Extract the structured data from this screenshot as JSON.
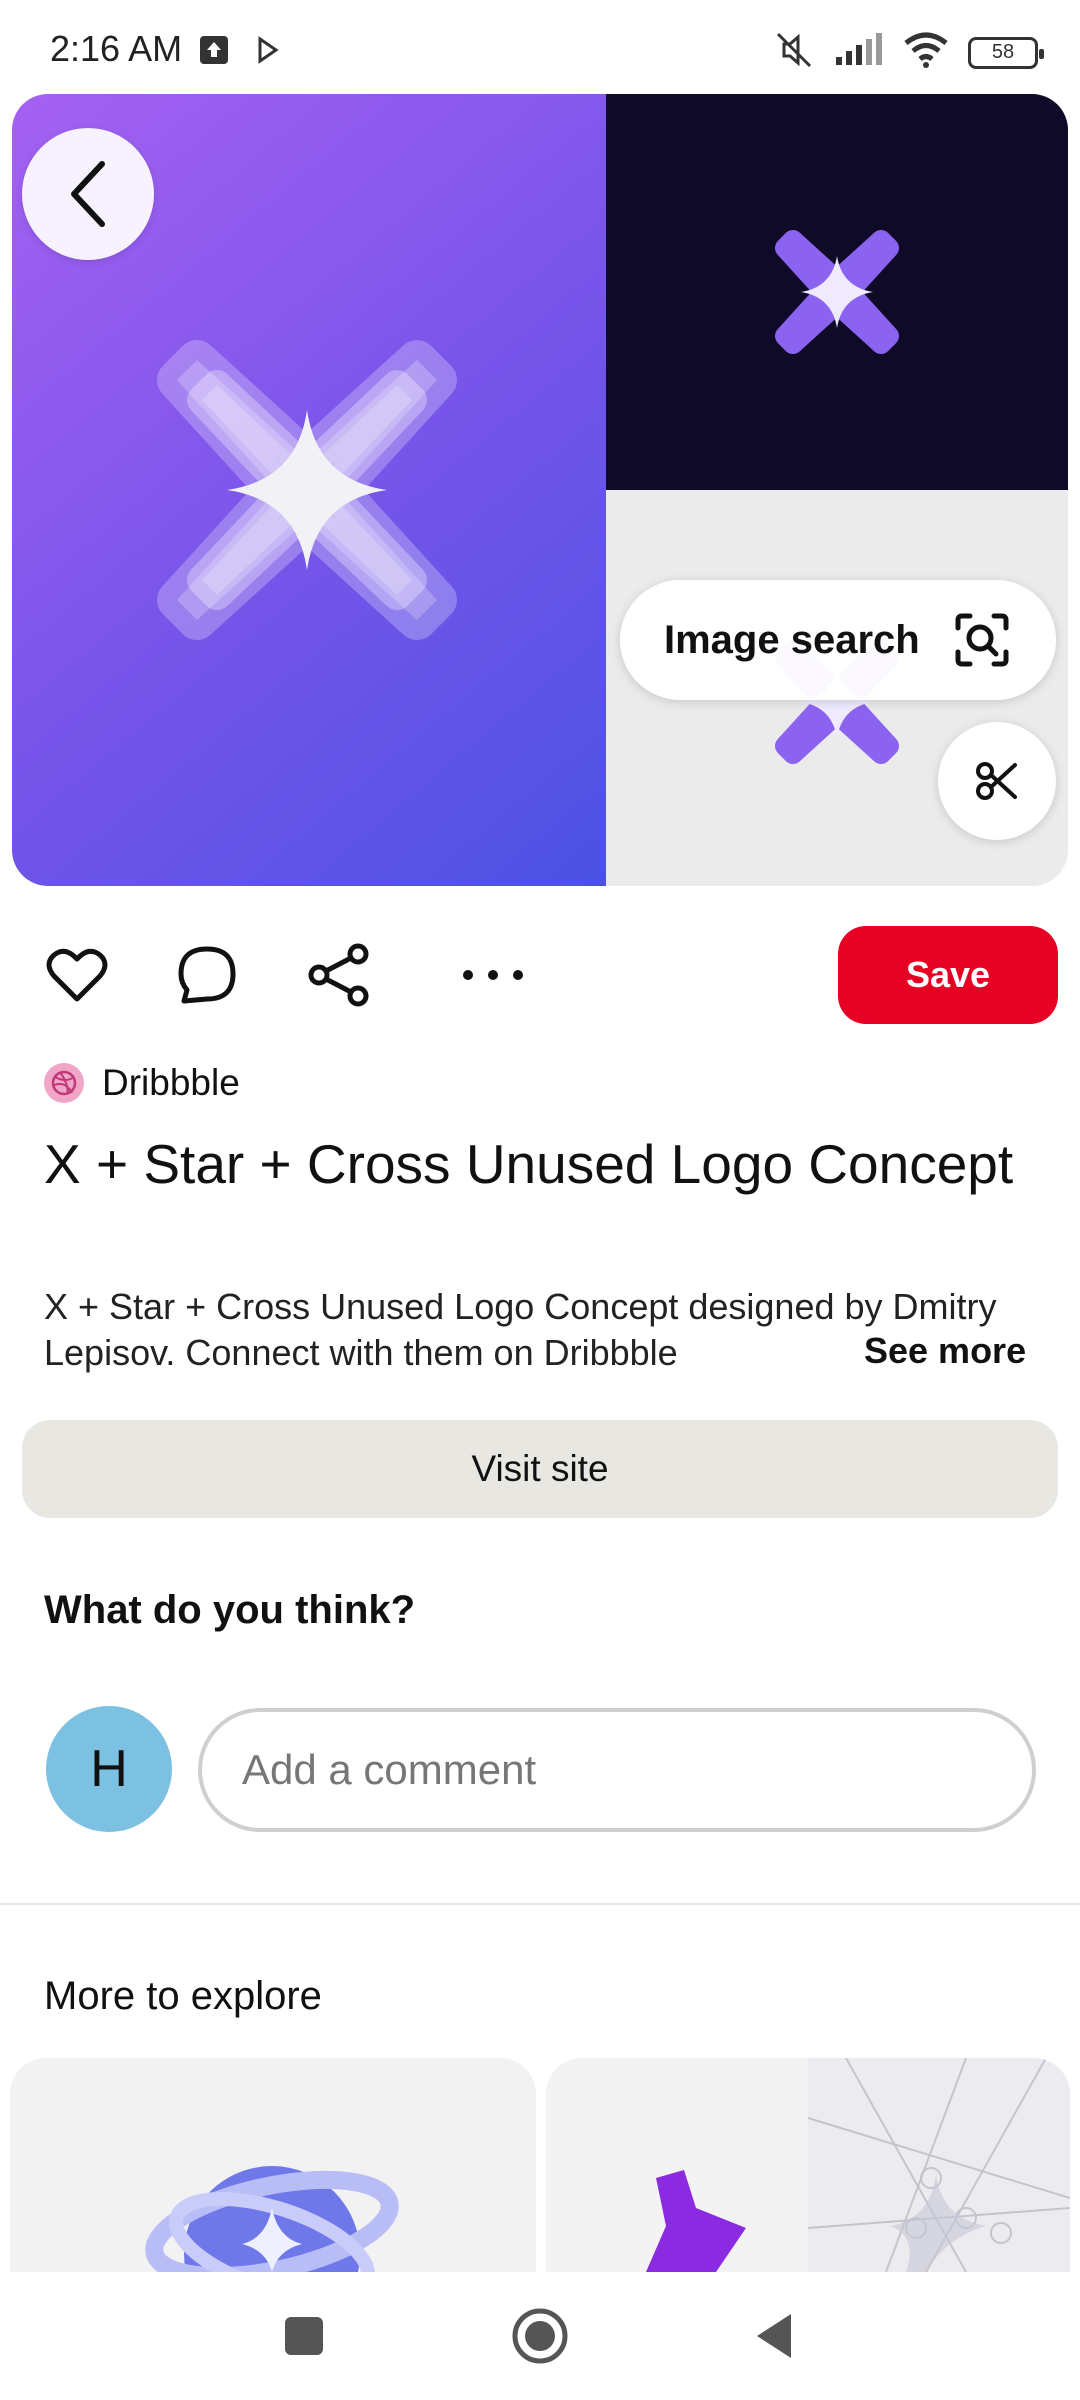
{
  "status_bar": {
    "time": "2:16 AM",
    "battery": "58"
  },
  "hero": {
    "image_search_label": "Image search"
  },
  "actions": {
    "save_label": "Save"
  },
  "pin": {
    "source_name": "Dribbble",
    "title": "X + Star + Cross Unused Logo Concept",
    "description": "X + Star + Cross Unused Logo Concept designed by Dmitry Lepisov. Connect with them on Dribbble",
    "see_more": "See more",
    "visit_site": "Visit site"
  },
  "comments": {
    "heading": "What do you think?",
    "avatar_initial": "H",
    "placeholder": "Add a comment"
  },
  "explore": {
    "heading": "More to explore"
  },
  "colors": {
    "save_red": "#e60023",
    "hero_gradient_start": "#a561f2",
    "hero_gradient_end": "#4a52e3",
    "avatar_blue": "#7cc1e2"
  }
}
